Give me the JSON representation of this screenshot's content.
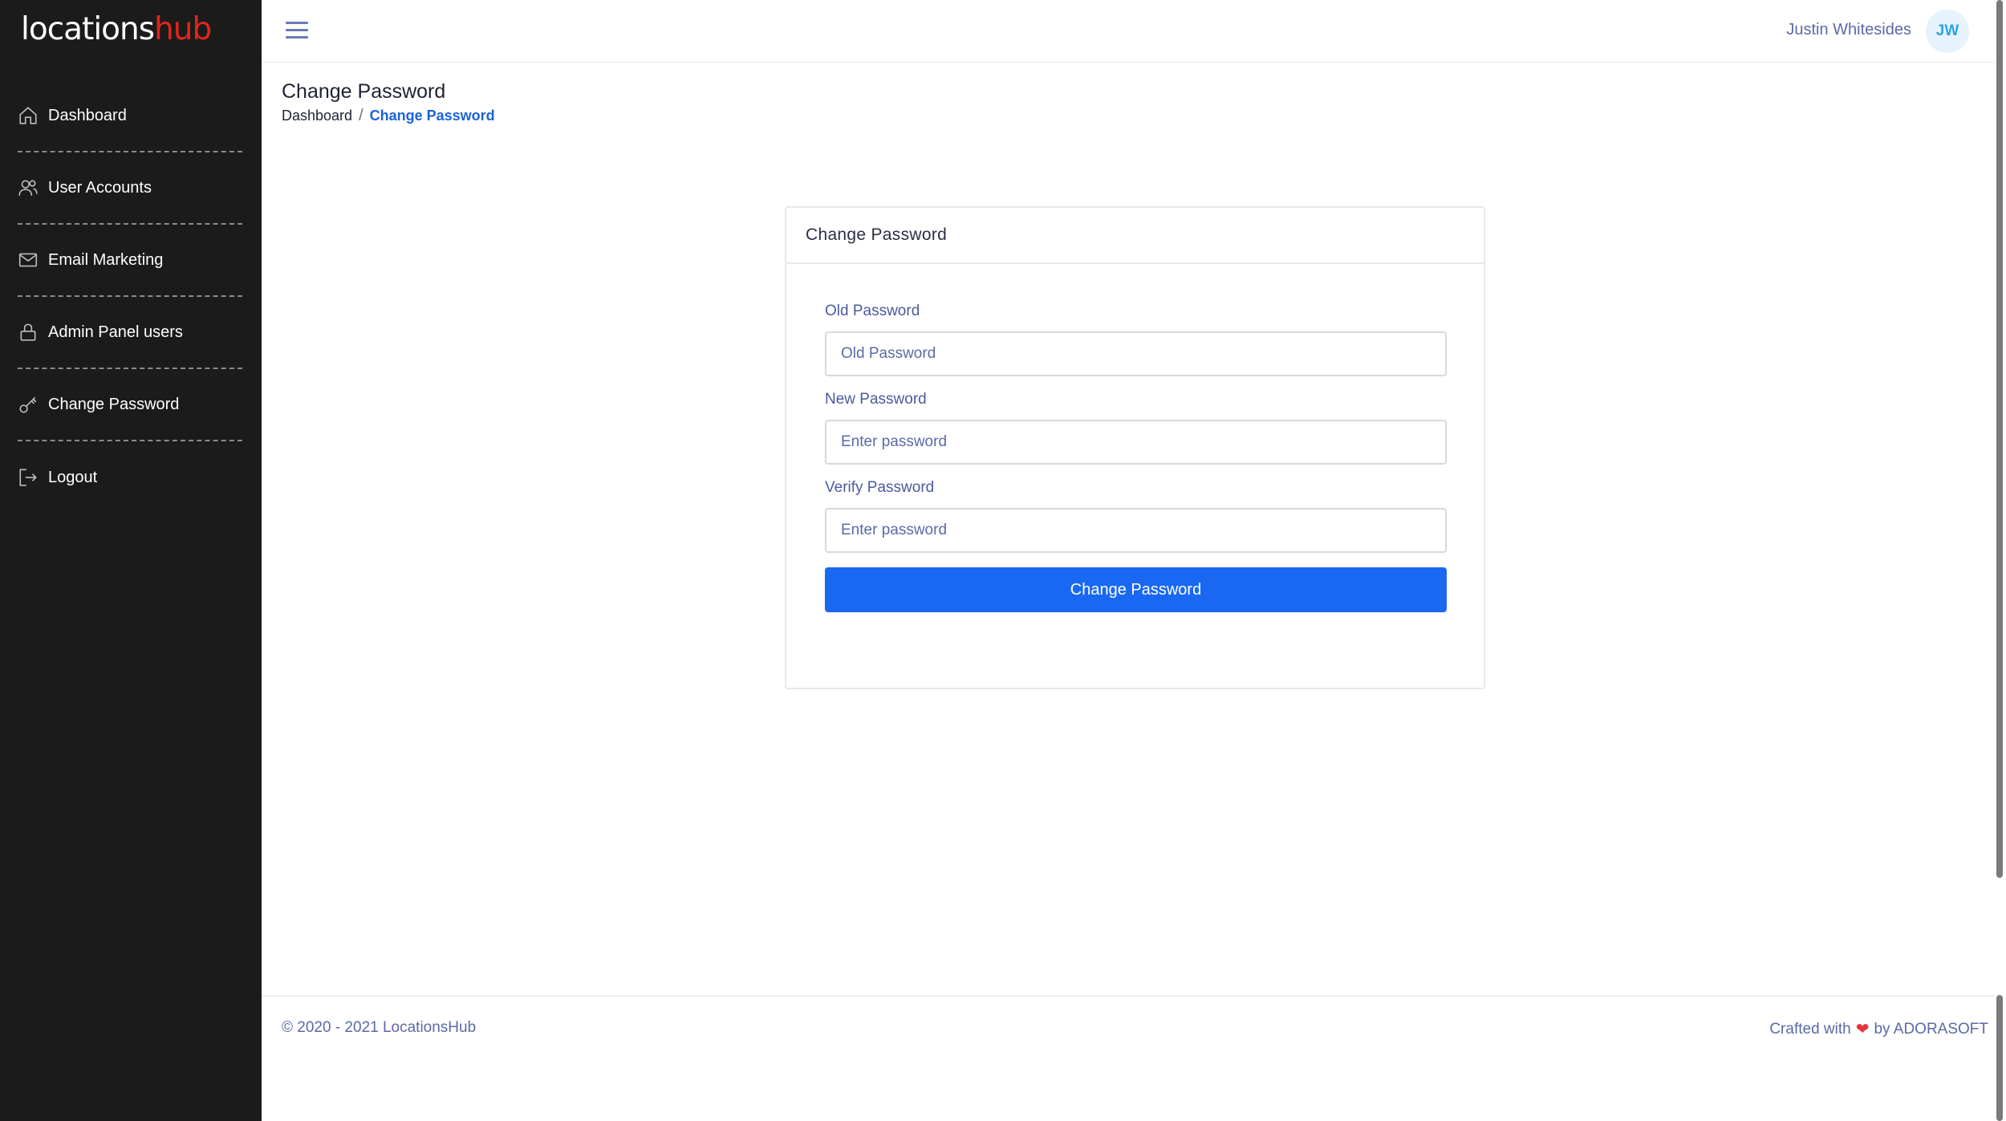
{
  "brand": {
    "part1": "locations",
    "part2": "hub"
  },
  "sidebar": {
    "items": [
      {
        "label": "Dashboard",
        "icon": "home-icon"
      },
      {
        "label": "User Accounts",
        "icon": "users-icon"
      },
      {
        "label": "Email Marketing",
        "icon": "mail-icon"
      },
      {
        "label": "Admin Panel users",
        "icon": "lock-icon"
      },
      {
        "label": "Change Password",
        "icon": "key-icon"
      },
      {
        "label": "Logout",
        "icon": "logout-icon"
      }
    ]
  },
  "topbar": {
    "menu_icon": "hamburger-menu-icon",
    "user_name": "Justin Whitesides",
    "user_initials": "JW"
  },
  "page": {
    "title": "Change Password",
    "breadcrumb": [
      "Dashboard",
      "Change Password"
    ],
    "separator": "/"
  },
  "card": {
    "title": "Change Password",
    "fields": [
      {
        "label": "Old Password",
        "placeholder": "Old Password"
      },
      {
        "label": "New Password",
        "placeholder": "Enter password"
      },
      {
        "label": "Verify Password",
        "placeholder": "Enter password"
      }
    ],
    "submit_label": "Change Password"
  },
  "footer": {
    "copyright": "© 2020 - 2021 LocationsHub",
    "crafted_prefix": "Crafted with",
    "heart": "❤",
    "crafted_suffix": "by ADORASOFT"
  },
  "colors": {
    "sidebar_bg": "#1b1b1b",
    "brand_accent": "#e0251c",
    "primary": "#1a68f2",
    "link": "#1d62d8"
  }
}
